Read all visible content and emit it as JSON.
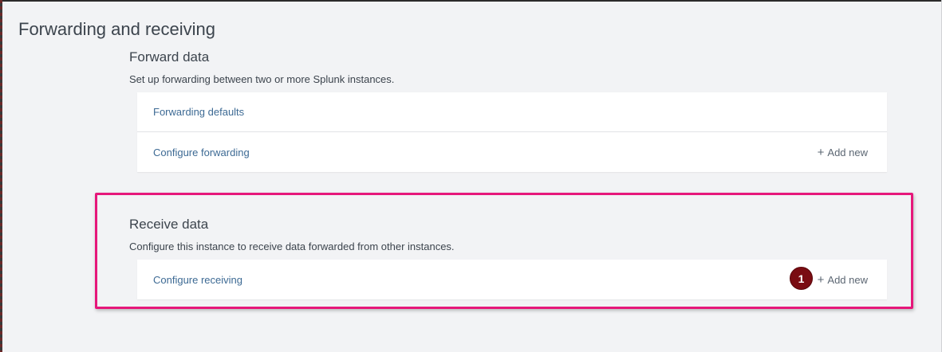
{
  "page": {
    "title": "Forwarding and receiving"
  },
  "forward": {
    "title": "Forward data",
    "description": "Set up forwarding between two or more Splunk instances.",
    "rows": [
      {
        "label": "Forwarding defaults"
      },
      {
        "label": "Configure forwarding",
        "action": "Add new"
      }
    ]
  },
  "receive": {
    "title": "Receive data",
    "description": "Configure this instance to receive data forwarded from other instances.",
    "rows": [
      {
        "label": "Configure receiving",
        "action": "Add new"
      }
    ]
  },
  "annotation": {
    "step": "1",
    "highlight_color": "#e6177a",
    "badge_color": "#7a0c12"
  },
  "colors": {
    "link": "#3d6a94",
    "background": "#f2f3f5",
    "text": "#3c444d"
  },
  "icons": {
    "add": "plus-icon"
  }
}
